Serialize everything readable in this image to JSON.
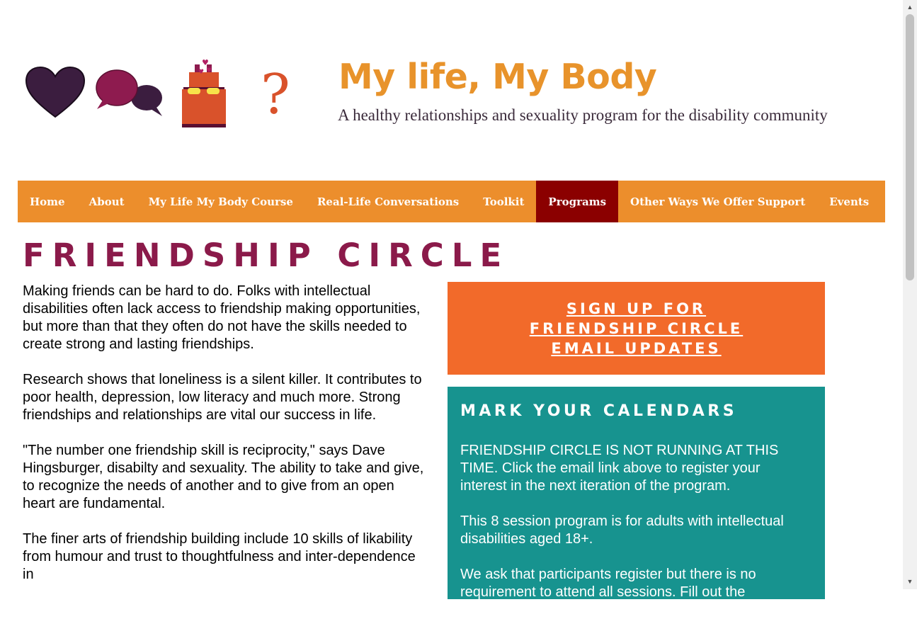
{
  "header": {
    "title": "My life, My Body",
    "subtitle": "A healthy relationships and sexuality program for the disability community",
    "logo_icons": [
      "heart-icon",
      "speech-bubbles-icon",
      "bed-icon",
      "question-mark-icon"
    ]
  },
  "nav": {
    "items": [
      {
        "label": "Home"
      },
      {
        "label": "About"
      },
      {
        "label": "My Life My Body Course"
      },
      {
        "label": "Real-Life Conversations"
      },
      {
        "label": "Toolkit"
      },
      {
        "label": "Programs"
      },
      {
        "label": "Other Ways We Offer Support"
      },
      {
        "label": "Events"
      }
    ],
    "active": "Programs"
  },
  "page": {
    "title": "FRIENDSHIP CIRCLE",
    "paragraphs": [
      "Making friends can be hard to do. Folks with intellectual disabilities often lack access to friendship making opportunities, but more than that they often do not have the skills needed to create strong and lasting friendships.",
      "Research shows that loneliness is a silent killer. It contributes to poor health, depression, low literacy and much more. Strong friendships and relationships are vital our success in life.",
      "\"The number one friendship skill is reciprocity,\" says Dave Hingsburger, disabilty and sexuality. The ability to take and give, to recognize the needs of another and to give from an open heart are fundamental.",
      "The finer arts of friendship building include 10 skills of likability from humour and trust to thoughtfulness and inter-dependence in"
    ]
  },
  "signup": {
    "label": "SIGN UP FOR FRIENDSHIP CIRCLE EMAIL UPDATES"
  },
  "calendar": {
    "heading": "MARK YOUR CALENDARS",
    "paragraphs": [
      "FRIENDSHIP CIRCLE IS NOT RUNNING AT THIS TIME. Click the email link above to register your interest in the next iteration of the program.",
      "This  8 session program is for adults with intellectual disabilities aged 18+.",
      "We ask that participants register but there is no requirement to attend all sessions. Fill out the"
    ]
  },
  "colors": {
    "nav_bg": "#ec8e2c",
    "nav_active": "#8b0000",
    "title_orange": "#e8932b",
    "page_title": "#8b1a4a",
    "signup_bg": "#f26a2a",
    "calendar_bg": "#17938f"
  }
}
